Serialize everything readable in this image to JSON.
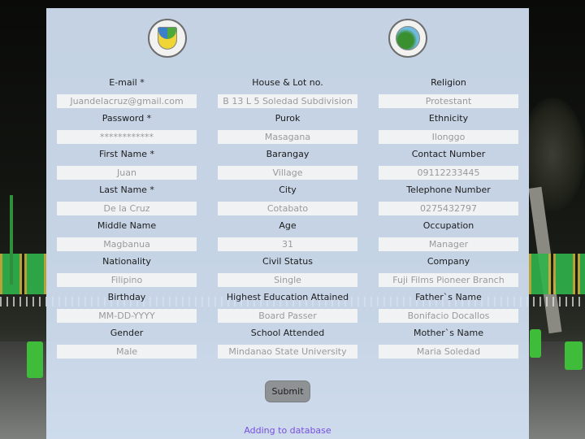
{
  "logos": {
    "left": "city-of-cotabato-seal-icon",
    "right": "barangay-seal-icon"
  },
  "form": {
    "columns": [
      [
        {
          "label": "E-mail *",
          "value": "Juandelacruz@gmail.com"
        },
        {
          "label": "Password *",
          "value": "************"
        },
        {
          "label": "First Name *",
          "value": "Juan"
        },
        {
          "label": "Last Name *",
          "value": "De la Cruz"
        },
        {
          "label": "Middle Name",
          "value": "Magbanua"
        },
        {
          "label": "Nationality",
          "value": "Filipino"
        },
        {
          "label": "Birthday",
          "value": "MM-DD-YYYY"
        },
        {
          "label": "Gender",
          "value": "Male"
        }
      ],
      [
        {
          "label": "House & Lot no.",
          "value": "B 13 L 5 Soledad Subdivision"
        },
        {
          "label": "Purok",
          "value": "Masagana"
        },
        {
          "label": "Barangay",
          "value": "Village"
        },
        {
          "label": "City",
          "value": "Cotabato"
        },
        {
          "label": "Age",
          "value": "31"
        },
        {
          "label": "Civil Status",
          "value": "Single"
        },
        {
          "label": "Highest Education Attained",
          "value": "Board Passer"
        },
        {
          "label": "School Attended",
          "value": "Mindanao State University"
        }
      ],
      [
        {
          "label": "Religion",
          "value": "Protestant"
        },
        {
          "label": "Ethnicity",
          "value": "Ilonggo"
        },
        {
          "label": "Contact Number",
          "value": "09112233445"
        },
        {
          "label": "Telephone Number",
          "value": "0275432797"
        },
        {
          "label": "Occupation",
          "value": "Manager"
        },
        {
          "label": "Company",
          "value": "Fuji Films Pioneer Branch"
        },
        {
          "label": "Father`s Name",
          "value": "Bonifacio Docallos"
        },
        {
          "label": "Mother`s Name",
          "value": "Maria Soledad"
        }
      ]
    ],
    "submit_label": "Submit",
    "status_text": "Adding to database"
  }
}
